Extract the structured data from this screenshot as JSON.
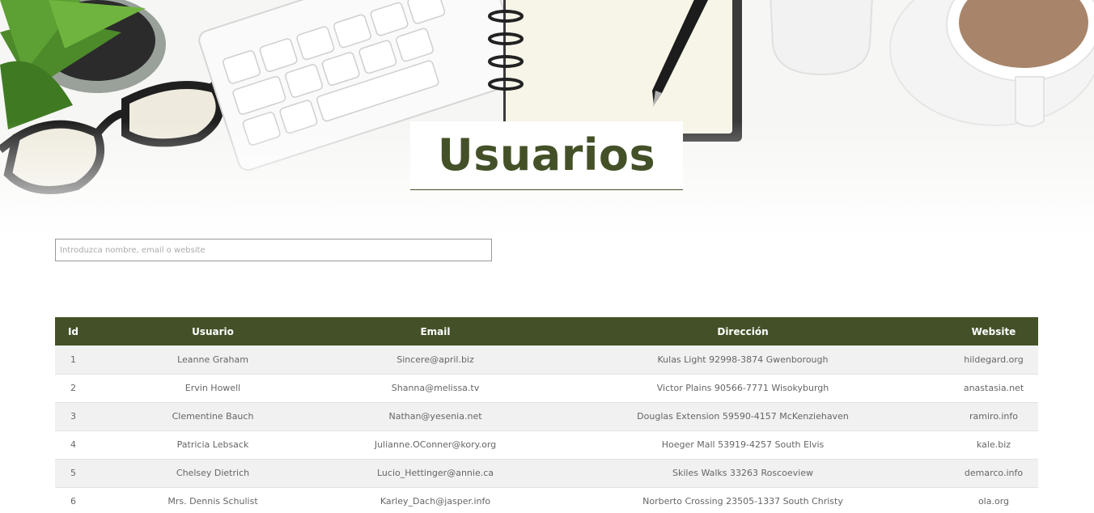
{
  "page": {
    "title": "Usuarios"
  },
  "search": {
    "placeholder": "Introduzca nombre, email o website",
    "value": ""
  },
  "table": {
    "headers": {
      "id": "Id",
      "user": "Usuario",
      "email": "Email",
      "address": "Dirección",
      "website": "Website"
    },
    "rows": [
      {
        "id": "1",
        "user": "Leanne Graham",
        "email": "Sincere@april.biz",
        "address": "Kulas Light 92998-3874 Gwenborough",
        "website": "hildegard.org"
      },
      {
        "id": "2",
        "user": "Ervin Howell",
        "email": "Shanna@melissa.tv",
        "address": "Victor Plains 90566-7771 Wisokyburgh",
        "website": "anastasia.net"
      },
      {
        "id": "3",
        "user": "Clementine Bauch",
        "email": "Nathan@yesenia.net",
        "address": "Douglas Extension 59590-4157 McKenziehaven",
        "website": "ramiro.info"
      },
      {
        "id": "4",
        "user": "Patricia Lebsack",
        "email": "Julianne.OConner@kory.org",
        "address": "Hoeger Mall 53919-4257 South Elvis",
        "website": "kale.biz"
      },
      {
        "id": "5",
        "user": "Chelsey Dietrich",
        "email": "Lucio_Hettinger@annie.ca",
        "address": "Skiles Walks 33263 Roscoeview",
        "website": "demarco.info"
      },
      {
        "id": "6",
        "user": "Mrs. Dennis Schulist",
        "email": "Karley_Dach@jasper.info",
        "address": "Norberto Crossing 23505-1337 South Christy",
        "website": "ola.org"
      }
    ]
  },
  "colors": {
    "accent": "#445128",
    "row_alt": "#f1f1f1"
  },
  "hero_icons": [
    "plant-icon",
    "glasses-icon",
    "keyboard-icon",
    "notebook-icon",
    "pen-icon",
    "mouse-icon",
    "coffee-cup-icon"
  ]
}
